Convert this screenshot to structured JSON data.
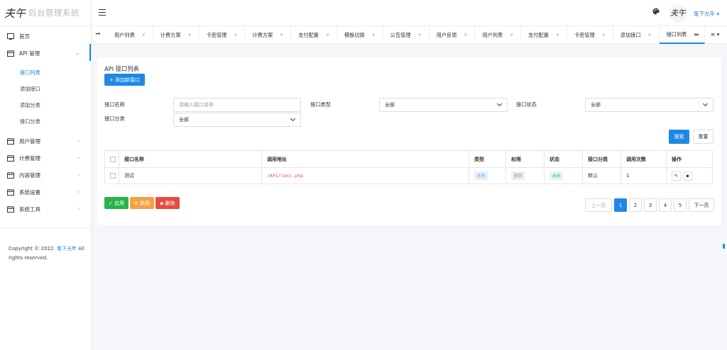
{
  "brand": {
    "mark": "夫午",
    "name": "后台管理系统"
  },
  "sidebar": {
    "items": [
      {
        "label": "首页",
        "icon": "home-icon"
      },
      {
        "label": "API 管理",
        "icon": "calendar-icon",
        "expanded": true,
        "children": [
          "接口列表",
          "添加接口",
          "添加分类",
          "接口分类"
        ]
      },
      {
        "label": "用户管理",
        "icon": "calendar-icon"
      },
      {
        "label": "计费管理",
        "icon": "calendar-icon"
      },
      {
        "label": "内容管理",
        "icon": "calendar-icon"
      },
      {
        "label": "系统设置",
        "icon": "calendar-icon"
      },
      {
        "label": "系统工具",
        "icon": "calendar-icon"
      }
    ],
    "active_child": "接口列表",
    "copyright_prefix": "Copyright © 2022.",
    "copyright_link": "笔下光年",
    "copyright_suffix": "All rights reserved."
  },
  "topbar": {
    "username": "笔下光年",
    "avatar_text": "夫午"
  },
  "tabs": {
    "items": [
      "用户列表",
      "计费方案",
      "卡密管理",
      "计费方案",
      "支付配置",
      "模板切换",
      "公告管理",
      "用户反馈",
      "用户列表",
      "支付配置",
      "卡密管理",
      "添加接口",
      "接口列表"
    ],
    "active_index": 12
  },
  "card": {
    "title": "API 接口列表",
    "add_button": "+ 添加新接口",
    "filters": {
      "name_label": "接口名称",
      "name_placeholder": "请输入接口名称",
      "type_label": "接口类型",
      "type_value": "全部",
      "status_label": "接口状态",
      "status_value": "全部",
      "category_label": "接口分类",
      "category_value": "全部"
    },
    "search_button": "搜索",
    "reset_button": "重置",
    "table": {
      "headers": [
        "接口名称",
        "调用地址",
        "类型",
        "权限",
        "状态",
        "接口分类",
        "调用次数",
        "操作"
      ],
      "rows": [
        {
          "name": "测试",
          "url": "/API/test.php",
          "type": "本地",
          "permission": "密钥",
          "status": "启用",
          "category": "默认",
          "calls": "1"
        }
      ]
    },
    "bulk": {
      "enable": "✓ 启用",
      "disable": "⊘ 禁用",
      "delete": "▪ 删除"
    },
    "pager": {
      "prev": "上一页",
      "pages": [
        "1",
        "2",
        "3",
        "4",
        "5"
      ],
      "current": "1",
      "next": "下一页"
    }
  },
  "colors": {
    "accent": "#1e88e5",
    "success": "#2bb34a",
    "warning": "#f5a142",
    "danger": "#e74c3c"
  }
}
